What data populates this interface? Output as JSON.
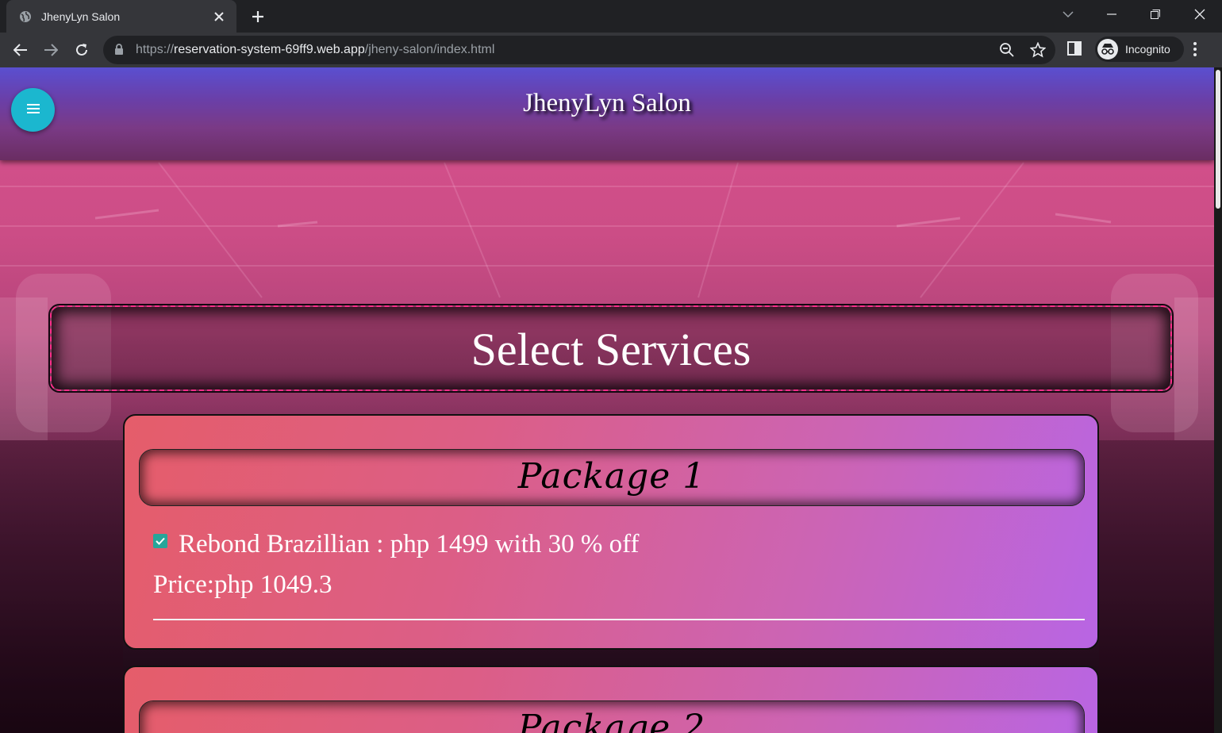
{
  "browser": {
    "tab_title": "JhenyLyn Salon",
    "url_scheme": "https://",
    "url_host": "reservation-system-69ff9.web.app",
    "url_path": "/jheny-salon/index.html",
    "incognito_label": "Incognito",
    "icons": [
      "globe-icon",
      "close-icon",
      "plus-icon",
      "back-icon",
      "forward-icon",
      "reload-icon",
      "lock-icon",
      "zoom-icon",
      "star-icon",
      "side-panel-icon",
      "incognito-icon",
      "kebab-icon",
      "minimize-icon",
      "restore-icon",
      "window-close-icon",
      "tab-search-icon"
    ]
  },
  "page": {
    "header_title": "JhenyLyn Salon",
    "menu_icon": "hamburger-icon",
    "section_title": "Select Services",
    "packages": [
      {
        "title": "Package 1",
        "service": {
          "checked": true,
          "label": "Rebond Brazillian : php 1499 with 30 % off"
        },
        "price": "Price:php 1049.3"
      },
      {
        "title": "Package 2"
      }
    ]
  },
  "colors": {
    "header_top": "#5a4fd0",
    "fab": "#1bb7cf",
    "checkbox": "#26a69a",
    "card_left": "#e55d6a",
    "card_right": "#b865e4",
    "select_border": "#ff2d8a"
  }
}
